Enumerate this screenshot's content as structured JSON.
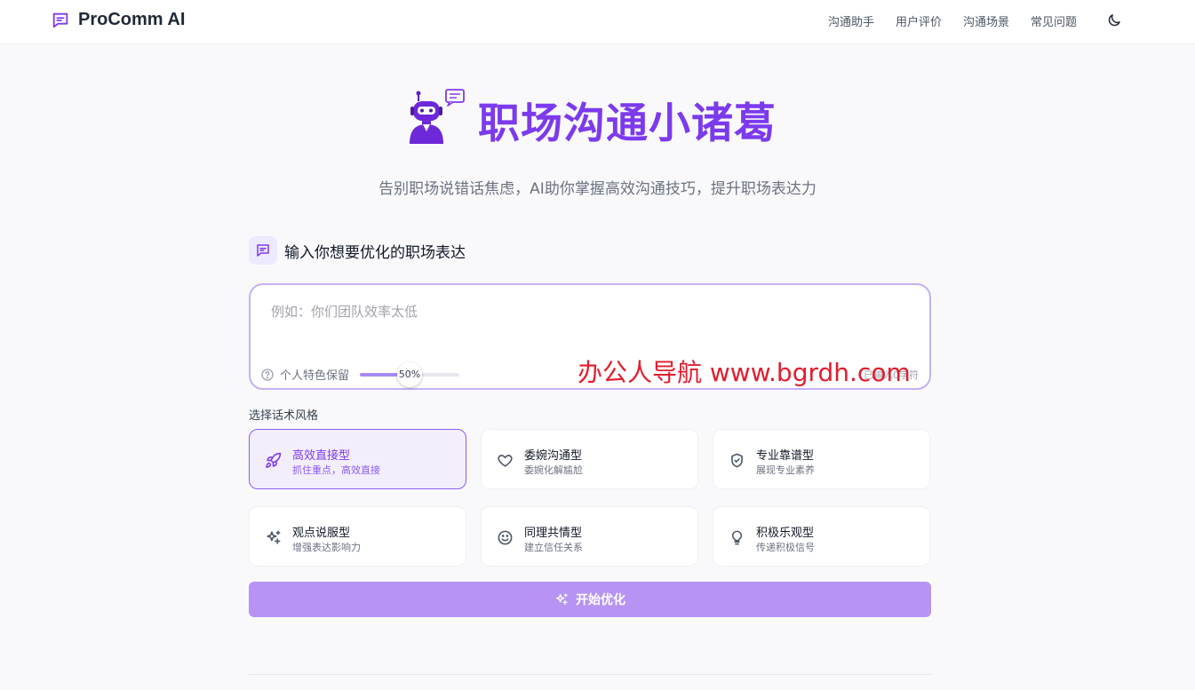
{
  "header": {
    "brand": "ProComm AI",
    "nav": [
      "沟通助手",
      "用户评价",
      "沟通场景",
      "常见问题"
    ]
  },
  "hero": {
    "title": "职场沟通小诸葛",
    "subtitle": "告别职场说错话焦虑，AI助你掌握高效沟通技巧，提升职场表达力"
  },
  "input": {
    "label": "输入你想要优化的职场表达",
    "placeholder": "例如：你们团队效率太低",
    "retention_label": "个人特色保留",
    "retention_value": 50,
    "retention_display": "50%",
    "char_count": "已输入0字符"
  },
  "watermark": "办公人导航 www.bgrdh.com",
  "styles": {
    "label": "选择话术风格",
    "items": [
      {
        "name": "高效直接型",
        "desc": "抓住重点，高效直接",
        "icon": "rocket-icon",
        "active": true
      },
      {
        "name": "委婉沟通型",
        "desc": "委婉化解尴尬",
        "icon": "heart-icon",
        "active": false
      },
      {
        "name": "专业靠谱型",
        "desc": "展现专业素养",
        "icon": "shield-icon",
        "active": false
      },
      {
        "name": "观点说服型",
        "desc": "增强表达影响力",
        "icon": "sparkles-icon",
        "active": false
      },
      {
        "name": "同理共情型",
        "desc": "建立信任关系",
        "icon": "smile-icon",
        "active": false
      },
      {
        "name": "积极乐观型",
        "desc": "传递积极信号",
        "icon": "lightbulb-icon",
        "active": false
      }
    ]
  },
  "start_button": "开始优化",
  "colors": {
    "accent": "#7c3aed",
    "button": "#b794f4",
    "watermark": "#e11d2e"
  }
}
